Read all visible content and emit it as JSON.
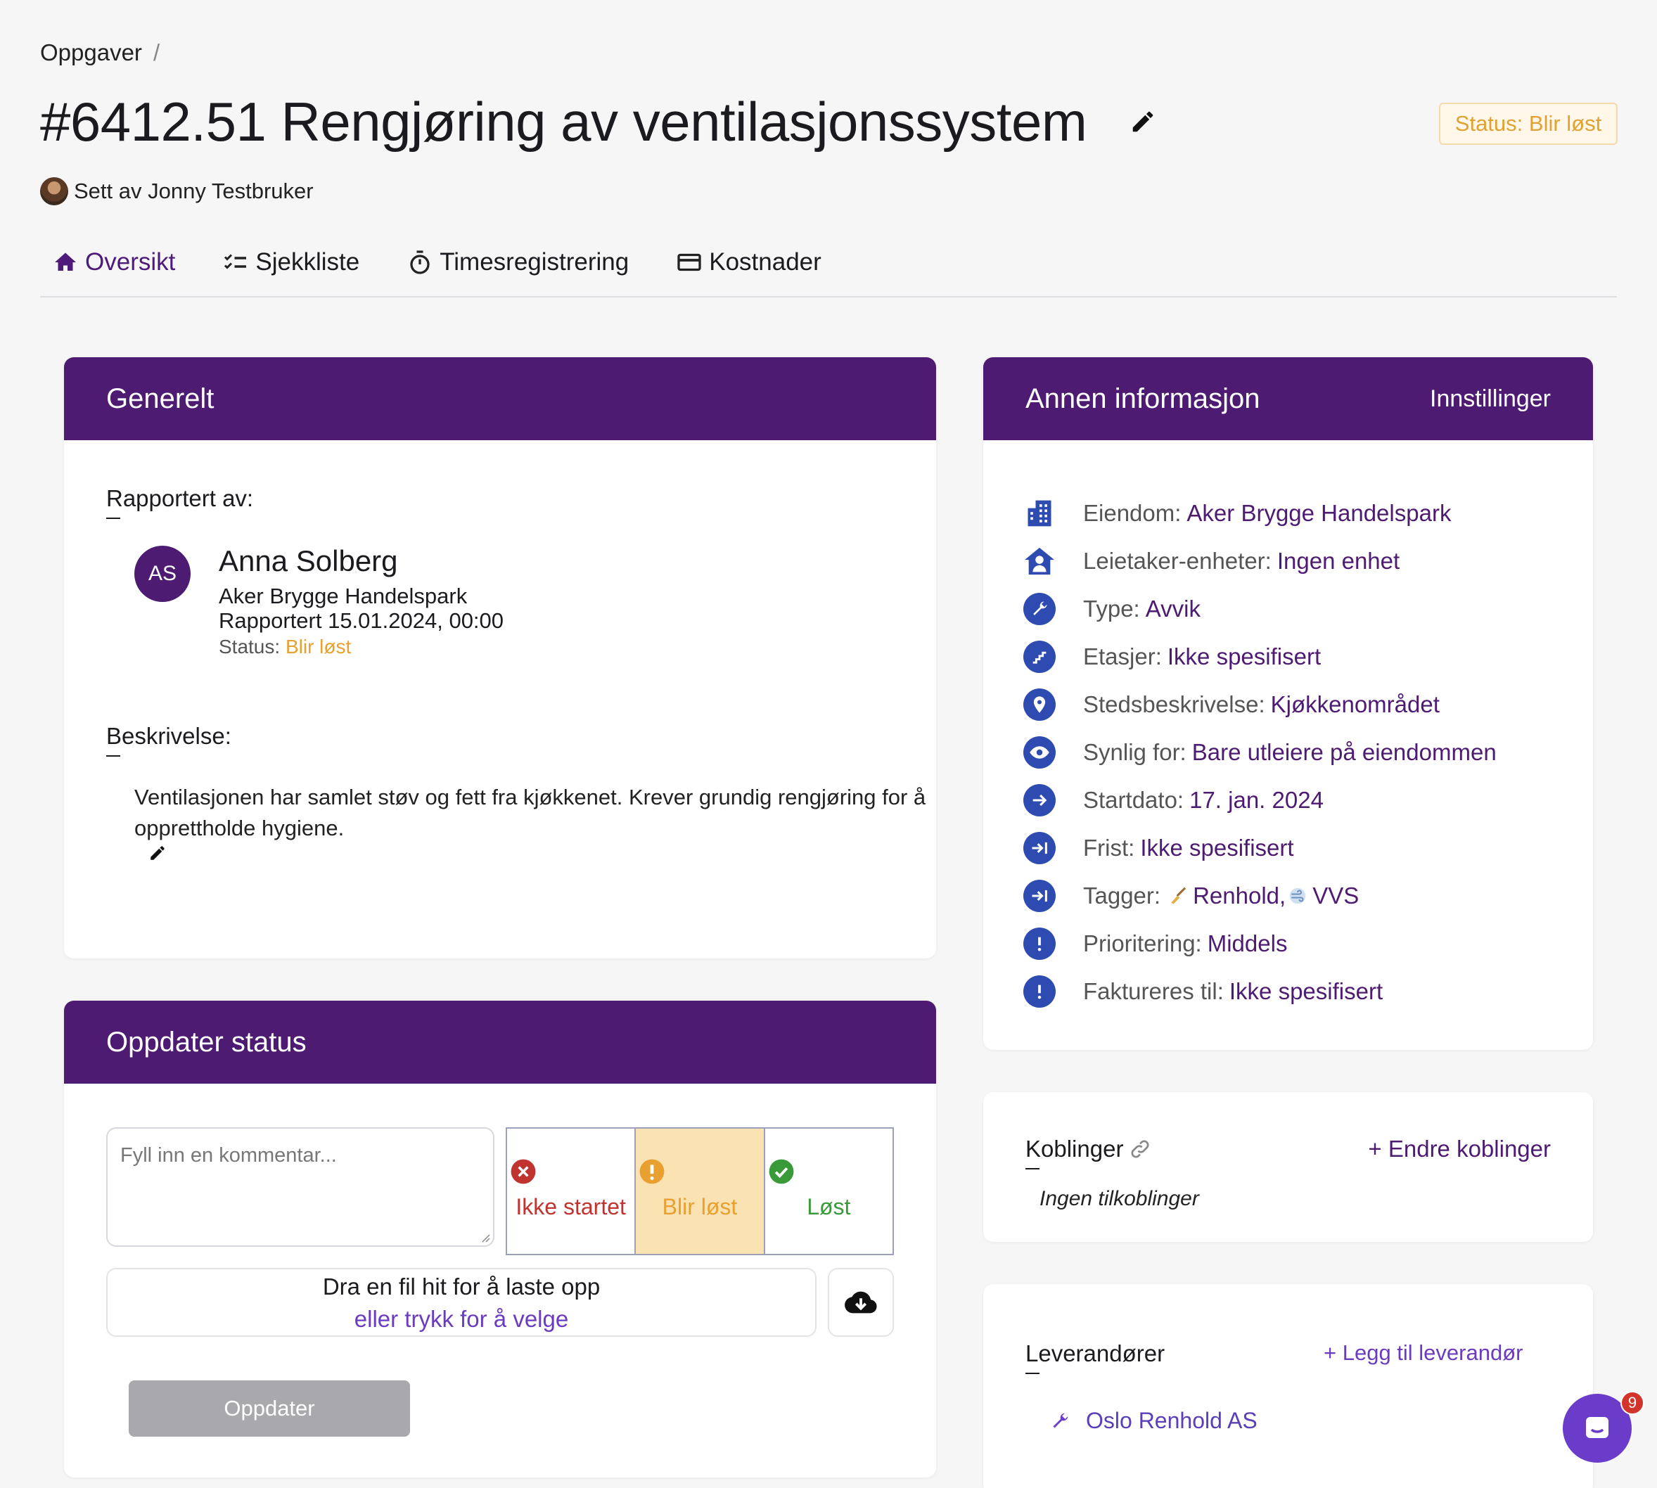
{
  "breadcrumb": {
    "root": "Oppgaver",
    "separator": "/"
  },
  "task": {
    "title": "#6412.51 Rengjøring av ventilasjonssystem",
    "status_pill": "Status: Blir løst",
    "set_by": "Sett av Jonny Testbruker"
  },
  "tabs": [
    {
      "label": "Oversikt",
      "icon": "home-icon",
      "active": true
    },
    {
      "label": "Sjekkliste",
      "icon": "checklist-icon"
    },
    {
      "label": "Timesregistrering",
      "icon": "stopwatch-icon"
    },
    {
      "label": "Kostnader",
      "icon": "credit-card-icon"
    }
  ],
  "general": {
    "header": "Generelt",
    "reported_by_label": "Rapportert av:",
    "reporter": {
      "initials": "AS",
      "name": "Anna Solberg",
      "property": "Aker Brygge Handelspark",
      "reported_at": "Rapportert 15.01.2024, 00:00",
      "status_label": "Status:",
      "status_value": "Blir løst"
    },
    "description_label": "Beskrivelse:",
    "description": "Ventilasjonen har samlet støv og fett fra kjøkkenet. Krever grundig rengjøring for å opprettholde hygiene."
  },
  "update_status": {
    "header": "Oppdater status",
    "comment_placeholder": "Fyll inn en kommentar...",
    "options": [
      {
        "label": "Ikke startet",
        "icon": "x-circle-icon",
        "color": "#c0332f"
      },
      {
        "label": "Blir løst",
        "icon": "exclamation-circle-icon",
        "color": "#e8a030",
        "selected": true
      },
      {
        "label": "Løst",
        "icon": "check-circle-icon",
        "color": "#3a9a3a"
      }
    ],
    "upload_primary": "Dra en fil hit for å laste opp",
    "upload_secondary": "eller trykk for å velge",
    "submit_label": "Oppdater"
  },
  "other_info": {
    "header": "Annen informasjon",
    "settings_link": "Innstillinger",
    "rows": [
      {
        "label": "Eiendom:",
        "value": "Aker Brygge Handelspark",
        "icon": "building-icon"
      },
      {
        "label": "Leietaker-enheter:",
        "value": "Ingen enhet",
        "icon": "house-person-icon"
      },
      {
        "label": "Type:",
        "value": "Avvik",
        "icon": "wrench-icon"
      },
      {
        "label": "Etasjer:",
        "value": "Ikke spesifisert",
        "icon": "stairs-icon"
      },
      {
        "label": "Stedsbeskrivelse:",
        "value": "Kjøkkenområdet",
        "icon": "location-pin-icon"
      },
      {
        "label": "Synlig for:",
        "value": "Bare utleiere på eiendommen",
        "icon": "eye-icon"
      },
      {
        "label": "Startdato:",
        "value": "17. jan. 2024",
        "icon": "arrow-right-icon"
      },
      {
        "label": "Frist:",
        "value": "Ikke spesifisert",
        "icon": "arrow-to-line-icon"
      },
      {
        "label": "Tagger:",
        "value": "Renhold,",
        "value2": "VVS",
        "icon": "arrow-to-line-icon"
      },
      {
        "label": "Prioritering:",
        "value": "Middels",
        "icon": "exclamation-icon",
        "value_color": "#e8a030"
      },
      {
        "label": "Faktureres til:",
        "value": "Ikke spesifisert",
        "icon": "exclamation-icon"
      }
    ]
  },
  "links": {
    "title": "Koblinger",
    "action": "+ Endre koblinger",
    "empty": "Ingen tilkoblinger"
  },
  "suppliers": {
    "title": "Leverandører",
    "action": "+ Legg til leverandør",
    "items": [
      "Oslo Renhold AS"
    ]
  },
  "chat": {
    "badge_count": "9"
  }
}
